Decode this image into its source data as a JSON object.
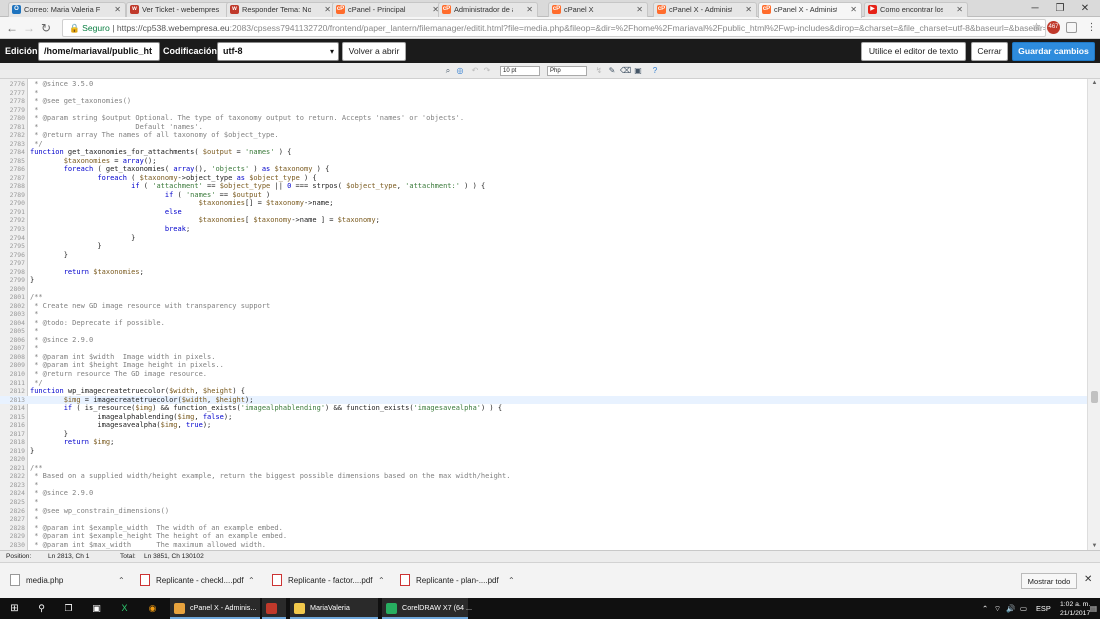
{
  "tabs": [
    {
      "label": "Correo: Maria Valeria F",
      "favicon": "O",
      "color": "#1e73be",
      "active": false
    },
    {
      "label": "Ver Ticket - webempres",
      "favicon": "w",
      "color": "#c0392b",
      "active": false
    },
    {
      "label": "Responder Tema: No p",
      "favicon": "w",
      "color": "#c0392b",
      "active": false
    },
    {
      "label": "cPanel - Principal",
      "favicon": "cP",
      "color": "#ff6c2c",
      "active": false
    },
    {
      "label": "Administrador de arch",
      "favicon": "cP",
      "color": "#ff6c2c",
      "active": false
    },
    {
      "label": "cPanel X",
      "favicon": "cP",
      "color": "#ff6c2c",
      "active": false
    },
    {
      "label": "cPanel X - Administrac",
      "favicon": "cP",
      "color": "#ff6c2c",
      "active": false
    },
    {
      "label": "cPanel X - Administrac",
      "favicon": "cP",
      "color": "#ff6c2c",
      "active": true
    },
    {
      "label": "Como encontrar los err",
      "favicon": "▶",
      "color": "#e62117",
      "active": false
    }
  ],
  "browser": {
    "secure_label": "Seguro",
    "url_host": "https://cp538.webempresa.eu",
    "url_path": ":2083/cpsess7941132720/frontend/paper_lantern/filemanager/editit.html?file=media.php&fileop=&dir=%2Fhome%2Fmariaval%2Fpublic_html%2Fwp-includes&dirop=&charset=&file_charset=utf-8&baseurl=&basedir=&codeedit=",
    "badge_count": "467"
  },
  "editor": {
    "edit_label": "Edición:",
    "path_value": "/home/mariaval/public_ht",
    "encoding_label": "Codificación:",
    "encoding_value": "utf-8",
    "reopen_button": "Volver a abrir",
    "text_editor_button": "Utilice el editor de texto",
    "close_button": "Cerrar",
    "save_button": "Guardar cambios",
    "font_size": "10 pt",
    "syntax": "Php"
  },
  "code_lines": [
    {
      "n": "2776",
      "html": "<span class=\"cm\"> * @since 3.5.0</span>"
    },
    {
      "n": "2777",
      "html": "<span class=\"cm\"> *</span>"
    },
    {
      "n": "2778",
      "html": "<span class=\"cm\"> * @see get_taxonomies()</span>"
    },
    {
      "n": "2779",
      "html": "<span class=\"cm\"> *</span>"
    },
    {
      "n": "2780",
      "html": "<span class=\"cm\"> * @param string $output Optional. The type of taxonomy output to return. Accepts 'names' or 'objects'.</span>"
    },
    {
      "n": "2781",
      "html": "<span class=\"cm\"> *                       Default 'names'.</span>"
    },
    {
      "n": "2782",
      "html": "<span class=\"cm\"> * @return array The names of all taxonomy of $object_type.</span>"
    },
    {
      "n": "2783",
      "html": "<span class=\"cm\"> */</span>"
    },
    {
      "n": "2784",
      "html": "<span class=\"kw\">function</span> get_taxonomies_for_attachments( <span class=\"vr\">$output</span> = <span class=\"st\">'names'</span> ) {"
    },
    {
      "n": "2785",
      "html": "        <span class=\"vr\">$taxonomies</span> = <span class=\"kw\">array</span>();"
    },
    {
      "n": "2786",
      "html": "        <span class=\"kw\">foreach</span> ( get_taxonomies( <span class=\"kw\">array</span>(), <span class=\"st\">'objects'</span> ) <span class=\"kw\">as</span> <span class=\"vr\">$taxonomy</span> ) {"
    },
    {
      "n": "2787",
      "html": "                <span class=\"kw\">foreach</span> ( <span class=\"vr\">$taxonomy</span>-&gt;object_type <span class=\"kw\">as</span> <span class=\"vr\">$object_type</span> ) {"
    },
    {
      "n": "2788",
      "html": "                        <span class=\"kw\">if</span> ( <span class=\"st\">'attachment'</span> == <span class=\"vr\">$object_type</span> || <span class=\"nb\">0</span> === strpos( <span class=\"vr\">$object_type</span>, <span class=\"st\">'attachment:'</span> ) ) {"
    },
    {
      "n": "2789",
      "html": "                                <span class=\"kw\">if</span> ( <span class=\"st\">'names'</span> == <span class=\"vr\">$output</span> )"
    },
    {
      "n": "2790",
      "html": "                                        <span class=\"vr\">$taxonomies</span>[] = <span class=\"vr\">$taxonomy</span>-&gt;name;"
    },
    {
      "n": "2791",
      "html": "                                <span class=\"kw\">else</span>"
    },
    {
      "n": "2792",
      "html": "                                        <span class=\"vr\">$taxonomies</span>[ <span class=\"vr\">$taxonomy</span>-&gt;name ] = <span class=\"vr\">$taxonomy</span>;"
    },
    {
      "n": "2793",
      "html": "                                <span class=\"kw\">break</span>;"
    },
    {
      "n": "2794",
      "html": "                        }"
    },
    {
      "n": "2795",
      "html": "                }"
    },
    {
      "n": "2796",
      "html": "        }"
    },
    {
      "n": "2797",
      "html": ""
    },
    {
      "n": "2798",
      "html": "        <span class=\"kw\">return</span> <span class=\"vr\">$taxonomies</span>;"
    },
    {
      "n": "2799",
      "html": "}"
    },
    {
      "n": "2800",
      "html": ""
    },
    {
      "n": "2801",
      "html": "<span class=\"cm\">/**</span>"
    },
    {
      "n": "2802",
      "html": "<span class=\"cm\"> * Create new GD image resource with transparency support</span>"
    },
    {
      "n": "2803",
      "html": "<span class=\"cm\"> *</span>"
    },
    {
      "n": "2804",
      "html": "<span class=\"cm\"> * @todo: Deprecate if possible.</span>"
    },
    {
      "n": "2805",
      "html": "<span class=\"cm\"> *</span>"
    },
    {
      "n": "2806",
      "html": "<span class=\"cm\"> * @since 2.9.0</span>"
    },
    {
      "n": "2807",
      "html": "<span class=\"cm\"> *</span>"
    },
    {
      "n": "2808",
      "html": "<span class=\"cm\"> * @param int $width  Image width in pixels.</span>"
    },
    {
      "n": "2809",
      "html": "<span class=\"cm\"> * @param int $height Image height in pixels..</span>"
    },
    {
      "n": "2810",
      "html": "<span class=\"cm\"> * @return resource The GD image resource.</span>"
    },
    {
      "n": "2811",
      "html": "<span class=\"cm\"> */</span>"
    },
    {
      "n": "2812",
      "html": "<span class=\"kw\">function</span> wp_imagecreatetruecolor(<span class=\"vr\">$width</span>, <span class=\"vr\">$height</span>) {"
    },
    {
      "n": "2813",
      "html": "        <span class=\"vr\">$img</span> = imagecreatetruecolor(<span class=\"vr\">$width</span>, <span class=\"vr\">$height</span>);",
      "hl": true
    },
    {
      "n": "2814",
      "html": "        <span class=\"kw\">if</span> ( is_resource(<span class=\"vr\">$img</span>) &amp;&amp; function_exists(<span class=\"st\">'imagealphablending'</span>) &amp;&amp; function_exists(<span class=\"st\">'imagesavealpha'</span>) ) {"
    },
    {
      "n": "2815",
      "html": "                imagealphablending(<span class=\"vr\">$img</span>, <span class=\"kw\">false</span>);"
    },
    {
      "n": "2816",
      "html": "                imagesavealpha(<span class=\"vr\">$img</span>, <span class=\"kw\">true</span>);"
    },
    {
      "n": "2817",
      "html": "        }"
    },
    {
      "n": "2818",
      "html": "        <span class=\"kw\">return</span> <span class=\"vr\">$img</span>;"
    },
    {
      "n": "2819",
      "html": "}"
    },
    {
      "n": "2820",
      "html": ""
    },
    {
      "n": "2821",
      "html": "<span class=\"cm\">/**</span>"
    },
    {
      "n": "2822",
      "html": "<span class=\"cm\"> * Based on a supplied width/height example, return the biggest possible dimensions based on the max width/height.</span>"
    },
    {
      "n": "2823",
      "html": "<span class=\"cm\"> *</span>"
    },
    {
      "n": "2824",
      "html": "<span class=\"cm\"> * @since 2.9.0</span>"
    },
    {
      "n": "2825",
      "html": "<span class=\"cm\"> *</span>"
    },
    {
      "n": "2826",
      "html": "<span class=\"cm\"> * @see wp_constrain_dimensions()</span>"
    },
    {
      "n": "2827",
      "html": "<span class=\"cm\"> *</span>"
    },
    {
      "n": "2828",
      "html": "<span class=\"cm\"> * @param int $example_width  The width of an example embed.</span>"
    },
    {
      "n": "2829",
      "html": "<span class=\"cm\"> * @param int $example_height The height of an example embed.</span>"
    },
    {
      "n": "2830",
      "html": "<span class=\"cm\"> * @param int $max_width      The maximum allowed width.</span>"
    }
  ],
  "status": {
    "position_label": "Position:",
    "position_value": "Ln 2813, Ch 1",
    "total_label": "Total:",
    "total_value": "Ln 3851, Ch 130102"
  },
  "downloads": [
    {
      "name": "media.php",
      "type": "php"
    },
    {
      "name": "Replicante - checkl....pdf",
      "type": "pdf"
    },
    {
      "name": "Replicante - factor....pdf",
      "type": "pdf"
    },
    {
      "name": "Replicante - plan-....pdf",
      "type": "pdf"
    }
  ],
  "downloads_show_all": "Mostrar todo",
  "taskbar": {
    "apps": [
      {
        "label": "cPanel X - Adminis...",
        "color": "#e8a33d"
      },
      {
        "label": "",
        "color": "#c0392b"
      },
      {
        "label": "MariaValeria",
        "color": "#f2c94c"
      },
      {
        "label": "CorelDRAW X7 (64 ...",
        "color": "#27ae60"
      }
    ],
    "lang": "ESP",
    "time": "1:02 a. m.",
    "date": "21/1/2017"
  }
}
